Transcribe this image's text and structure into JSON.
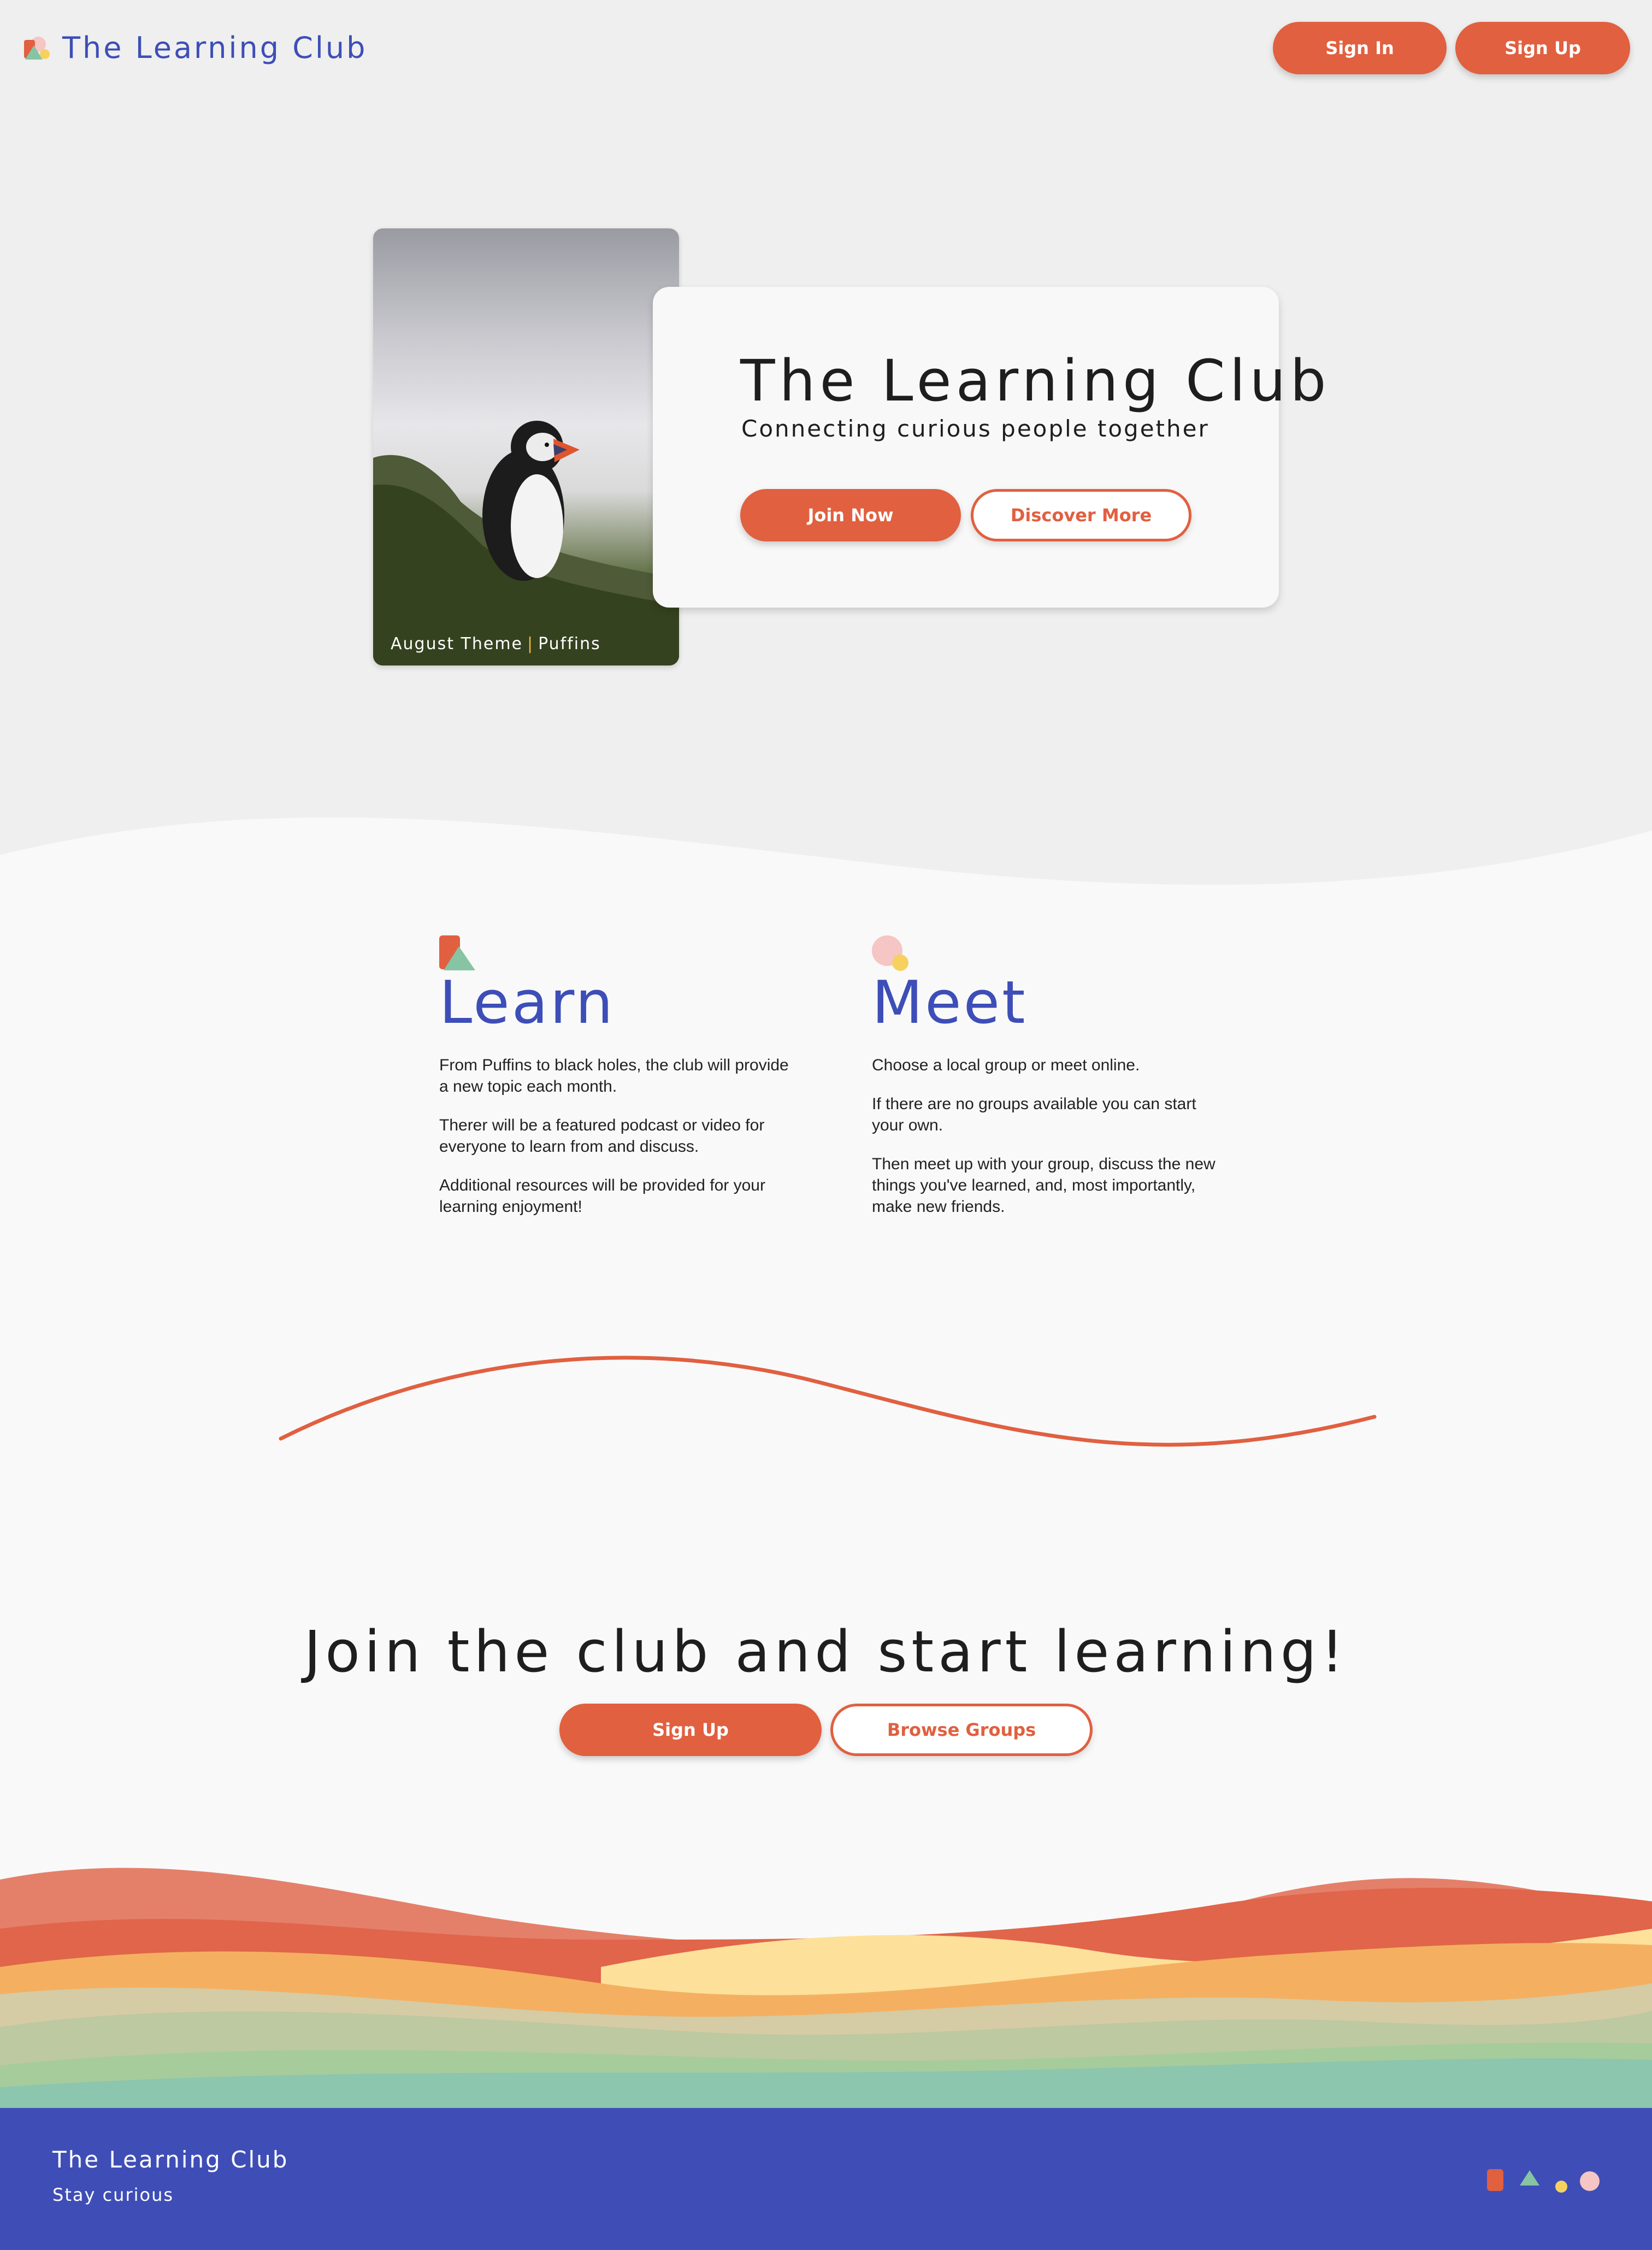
{
  "header": {
    "brand": "The Learning Club",
    "sign_in": "Sign In",
    "sign_up": "Sign Up"
  },
  "hero": {
    "image_caption_theme": "August Theme",
    "image_caption_separator": "|",
    "image_caption_topic": "Puffins",
    "title": "The Learning Club",
    "subtitle": "Connecting curious people together",
    "join_now": "Join Now",
    "discover_more": "Discover More"
  },
  "features": {
    "learn": {
      "title": "Learn",
      "paragraphs": [
        "From Puffins to black holes, the club will provide a new topic each month.",
        "Therer will be a featured podcast or video for everyone to learn from and discuss.",
        "Additional resources will be provided for your learning enjoyment!"
      ]
    },
    "meet": {
      "title": "Meet",
      "paragraphs": [
        "Choose a local group or meet online.",
        "If there are no groups available you can start your own.",
        "Then meet up with your group, discuss the new things you've learned, and, most importantly, make new friends."
      ]
    }
  },
  "cta": {
    "title": "Join the club and start learning!",
    "sign_up": "Sign Up",
    "browse_groups": "Browse Groups"
  },
  "footer": {
    "title": "The Learning Club",
    "tagline": "Stay curious"
  },
  "colors": {
    "accent": "#e06040",
    "brand_blue": "#3f4eb6",
    "green": "#86c4a4",
    "yellow": "#f7d160",
    "pink": "#f5c6c4",
    "orange": "#f2a654"
  },
  "icons": [
    "logo-shapes-icon",
    "learn-shapes-icon",
    "meet-circles-icon",
    "footer-shapes-icon"
  ]
}
